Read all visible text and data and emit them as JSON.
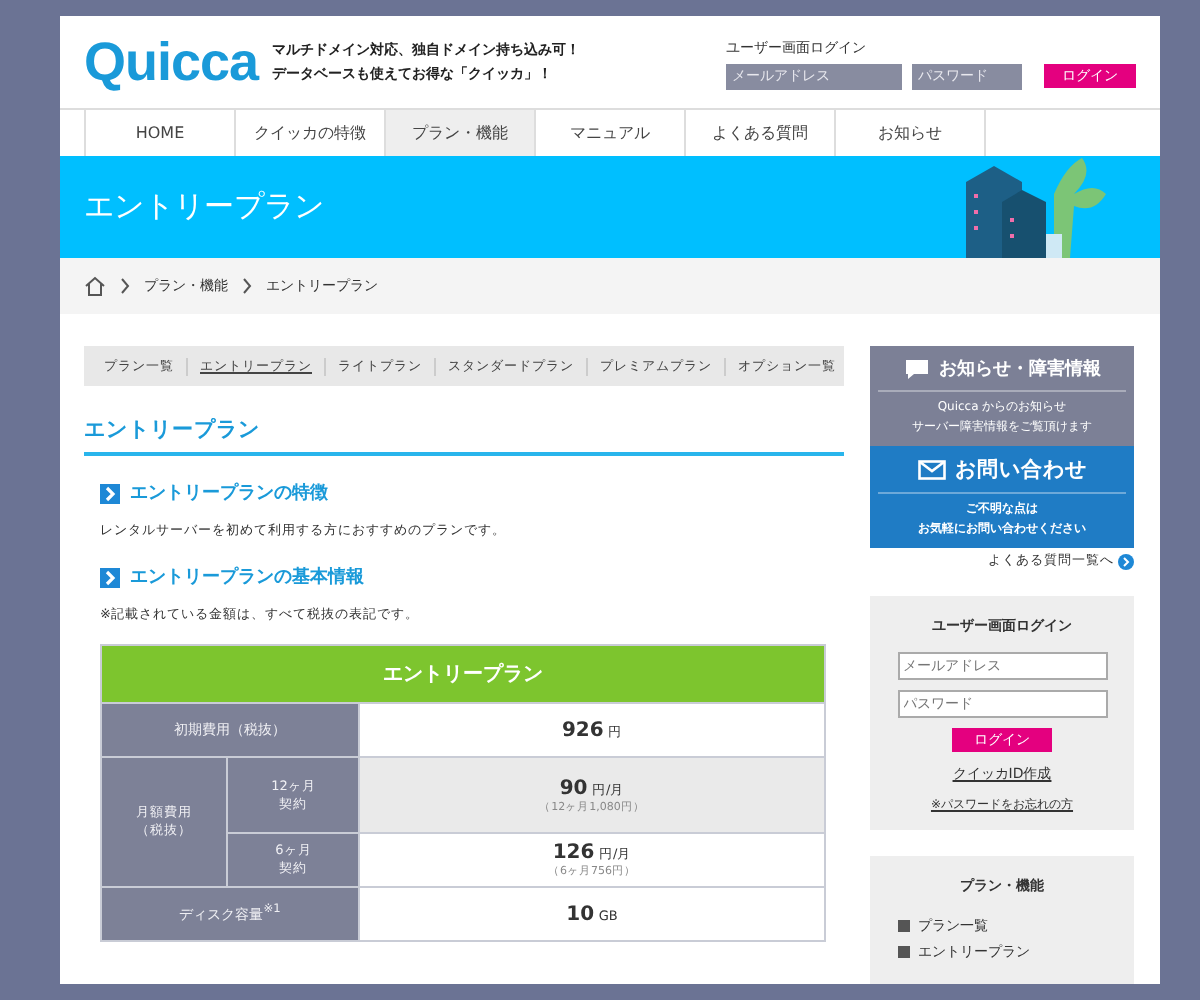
{
  "header": {
    "logo": "Quicca",
    "tagline": [
      "マルチドメイン対応、独自ドメイン持ち込み可！",
      "データベースも使えてお得な「クイッカ」！"
    ],
    "login": {
      "label": "ユーザー画面ログイン",
      "email_placeholder": "メールアドレス",
      "password_placeholder": "パスワード",
      "button": "ログイン"
    }
  },
  "nav": [
    {
      "label": "HOME",
      "selected": false
    },
    {
      "label": "クイッカの特徴",
      "selected": false
    },
    {
      "label": "プラン・機能",
      "selected": true
    },
    {
      "label": "マニュアル",
      "selected": false
    },
    {
      "label": "よくある質問",
      "selected": false
    },
    {
      "label": "お知らせ",
      "selected": false
    }
  ],
  "banner": {
    "title": "エントリープラン"
  },
  "breadcrumb": [
    "プラン・機能",
    "エントリープラン"
  ],
  "subnav": [
    {
      "label": "プラン一覧",
      "selected": false
    },
    {
      "label": "エントリープラン",
      "selected": true
    },
    {
      "label": "ライトプラン",
      "selected": false
    },
    {
      "label": "スタンダードプラン",
      "selected": false
    },
    {
      "label": "プレミアムプラン",
      "selected": false
    },
    {
      "label": "オプション一覧",
      "selected": false
    }
  ],
  "content": {
    "title": "エントリープラン",
    "sections": [
      {
        "heading": "エントリープランの特徴",
        "text": "レンタルサーバーを初めて利用する方におすすめのプランです。"
      },
      {
        "heading": "エントリープランの基本情報",
        "text": "※記載されている金額は、すべて税抜の表記です。"
      }
    ]
  },
  "table": {
    "title": "エントリープラン",
    "rows": [
      {
        "kind": "single",
        "label": "初期費用（税抜）",
        "value": "926",
        "unit": "円"
      },
      {
        "kind": "group",
        "label": [
          "月額費用",
          "（税抜）"
        ],
        "items": [
          {
            "label": [
              "12ヶ月",
              "契約"
            ],
            "value": "90",
            "unit": "円/月",
            "note": "（12ヶ月1,080円）"
          },
          {
            "label": [
              "6ヶ月",
              "契約"
            ],
            "value": "126",
            "unit": "円/月",
            "note": "（6ヶ月756円）"
          }
        ]
      },
      {
        "kind": "single",
        "label": "ディスク容量$^{※1}$",
        "value": "10",
        "unit": "GB"
      }
    ]
  },
  "sidebar": {
    "news": {
      "title": "お知らせ・障害情報",
      "text": [
        "Quicca からのお知らせ",
        "サーバー障害情報をご覧頂けます"
      ]
    },
    "contact": {
      "title": "お問い合わせ",
      "text": [
        "ご不明な点は",
        "お気軽にお問い合わせください"
      ]
    },
    "faq_link": "よくある質問一覧へ",
    "login": {
      "title": "ユーザー画面ログイン",
      "email_placeholder": "メールアドレス",
      "password_placeholder": "パスワード",
      "button": "ログイン",
      "create_link": "クイッカID作成",
      "forgot_link": "※パスワードをお忘れの方"
    },
    "plans": {
      "title": "プラン・機能",
      "items": [
        "プラン一覧",
        "エントリープラン"
      ]
    }
  }
}
